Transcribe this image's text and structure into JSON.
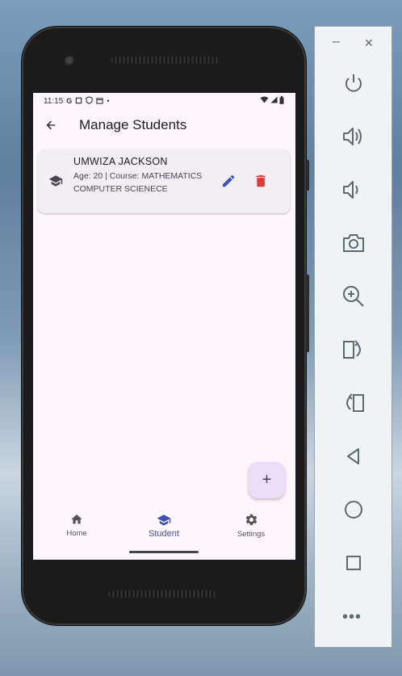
{
  "status_bar": {
    "time": "11:15",
    "google_icon": "G",
    "dot": "•"
  },
  "app_bar": {
    "title": "Manage Students"
  },
  "students": [
    {
      "name": "UMWIZA JACKSON",
      "details": "Age: 20 | Course: MATHEMATICS COMPUTER SCIENECE"
    }
  ],
  "fab": {
    "label": "+"
  },
  "bottom_nav": {
    "items": [
      {
        "label": "Home",
        "icon": "home-icon"
      },
      {
        "label": "Student",
        "icon": "school-icon",
        "active": true
      },
      {
        "label": "Settings",
        "icon": "gear-icon"
      }
    ]
  },
  "emulator_panel": {
    "minimize": "–",
    "close": "✕",
    "controls": [
      "power",
      "volume-up",
      "volume-down",
      "screenshot",
      "zoom",
      "rotate-left",
      "rotate-right",
      "back",
      "home",
      "overview",
      "more"
    ],
    "more_label": "•••"
  },
  "colors": {
    "accent": "#3f51b5",
    "delete": "#e53935",
    "fab_bg": "#e8def8",
    "panel_icon": "#5b6a73"
  }
}
